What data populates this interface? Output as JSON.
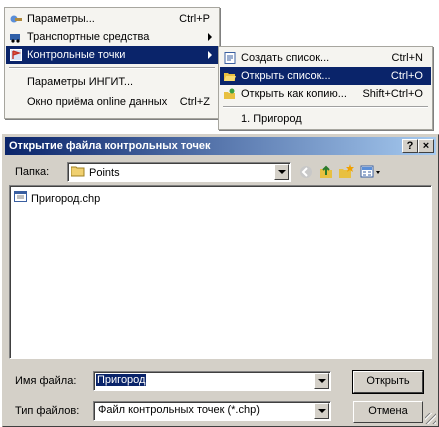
{
  "menu_main": {
    "items": [
      {
        "label": "Параметры...",
        "shortcut": "Ctrl+P",
        "icon": "wrench-icon"
      },
      {
        "label": "Транспортные средства",
        "icon": "vehicle-icon",
        "submenu": true
      },
      {
        "label": "Контрольные точки",
        "icon": "checkpoint-icon",
        "submenu": true,
        "highlighted": true
      },
      {
        "label": "Параметры ИНГИТ..."
      },
      {
        "label": "Окно приёма online данных",
        "shortcut": "Ctrl+Z"
      }
    ]
  },
  "menu_sub": {
    "items": [
      {
        "label": "Создать список...",
        "shortcut": "Ctrl+N",
        "icon": "new-list-icon"
      },
      {
        "label": "Открыть список...",
        "shortcut": "Ctrl+O",
        "icon": "open-folder-icon",
        "highlighted": true
      },
      {
        "label": "Открыть как копию...",
        "shortcut": "Shift+Ctrl+O",
        "icon": "open-copy-icon"
      },
      {
        "label": "1. Пригород"
      }
    ]
  },
  "dialog": {
    "title": "Открытие файла контрольных точек",
    "help_button": "?",
    "close_button": "×",
    "folder_label": "Папка:",
    "folder_value": "Points",
    "files": [
      {
        "name": "Пригород.chp"
      }
    ],
    "filename_label": "Имя файла:",
    "filename_value": "Пригород",
    "filetype_label": "Тип файлов:",
    "filetype_value": "Файл контрольных точек (*.chp)",
    "open_button": "Открыть",
    "cancel_button": "Отмена"
  },
  "colors": {
    "highlight": "#0a246a",
    "face": "#d4d0c8",
    "menu_bg": "#f5f4f0"
  }
}
